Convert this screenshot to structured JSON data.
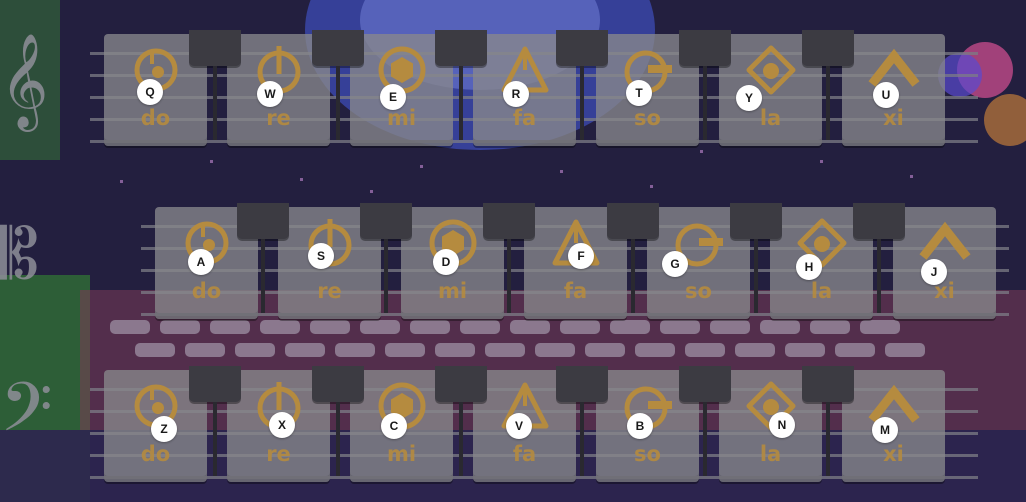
{
  "game": {
    "rows": [
      {
        "clef": "𝄞",
        "clef_name": "treble",
        "keys": [
          {
            "hotkey": "Q",
            "label": "do",
            "icon": "circle-dot-icon"
          },
          {
            "hotkey": "W",
            "label": "re",
            "icon": "circle-stem-icon"
          },
          {
            "hotkey": "E",
            "label": "mi",
            "icon": "circle-hexagon-icon"
          },
          {
            "hotkey": "R",
            "label": "fa",
            "icon": "triangle-icon"
          },
          {
            "hotkey": "T",
            "label": "so",
            "icon": "circle-dash-icon"
          },
          {
            "hotkey": "Y",
            "label": "la",
            "icon": "diamond-dot-icon"
          },
          {
            "hotkey": "U",
            "label": "xi",
            "icon": "chevron-up-icon"
          }
        ]
      },
      {
        "clef": "𝄡",
        "clef_name": "alto",
        "keys": [
          {
            "hotkey": "A",
            "label": "do",
            "icon": "circle-dot-icon"
          },
          {
            "hotkey": "S",
            "label": "re",
            "icon": "circle-stem-icon"
          },
          {
            "hotkey": "D",
            "label": "mi",
            "icon": "circle-hexagon-icon"
          },
          {
            "hotkey": "F",
            "label": "fa",
            "icon": "triangle-icon"
          },
          {
            "hotkey": "G",
            "label": "so",
            "icon": "circle-dash-icon"
          },
          {
            "hotkey": "H",
            "label": "la",
            "icon": "diamond-dot-icon"
          },
          {
            "hotkey": "J",
            "label": "xi",
            "icon": "chevron-up-icon"
          }
        ]
      },
      {
        "clef": "𝄢",
        "clef_name": "bass",
        "keys": [
          {
            "hotkey": "Z",
            "label": "do",
            "icon": "circle-dot-icon"
          },
          {
            "hotkey": "X",
            "label": "re",
            "icon": "circle-stem-icon"
          },
          {
            "hotkey": "C",
            "label": "mi",
            "icon": "circle-hexagon-icon"
          },
          {
            "hotkey": "V",
            "label": "fa",
            "icon": "triangle-icon"
          },
          {
            "hotkey": "B",
            "label": "so",
            "icon": "circle-dash-icon"
          },
          {
            "hotkey": "N",
            "label": "la",
            "icon": "diamond-dot-icon"
          },
          {
            "hotkey": "M",
            "label": "xi",
            "icon": "chevron-up-icon"
          }
        ]
      }
    ],
    "colors": {
      "accent": "#b58b3f",
      "key": "#88888c",
      "black_key": "#3c3b42",
      "background": "#231f3f"
    }
  }
}
